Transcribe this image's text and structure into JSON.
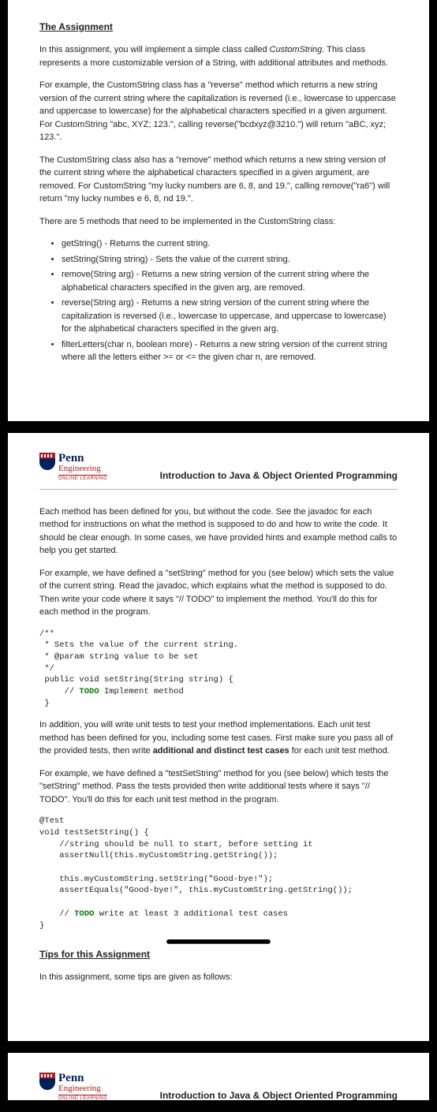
{
  "page1": {
    "title": "The Assignment",
    "p1_a": "In this assignment, you will implement a simple class called ",
    "p1_i": "CustomString",
    "p1_b": ".  This class represents a more customizable version of a String, with additional attributes and methods.",
    "p2": "For example, the CustomString class has a \"reverse\" method which returns a new string version of the current string where the capitalization is reversed (i.e., lowercase to uppercase and uppercase to lowercase) for the alphabetical characters specified in a given argument.  For CustomString \"abc, XYZ; 123.\", calling reverse(\"bcdxyz@3210.\") will return \"aBC, xyz; 123.\".",
    "p3": "The CustomString class also has a \"remove\" method which returns a new string version of the current string where the alphabetical characters specified in a given argument, are removed. For CustomString \"my lucky numbers are 6, 8, and 19.\", calling remove(\"ra6\") will return \"my lucky numbes e 6, 8, nd 19.\".",
    "p4": "There are 5 methods that need to be implemented in the CustomString class:",
    "methods": [
      "getString() - Returns the current string.",
      "setString(String string) - Sets the value of the current string.",
      "remove(String arg) - Returns a new string version of the current string where the alphabetical characters specified in the given arg, are removed.",
      "reverse(String arg) - Returns a new string version of the current string where the capitalization is reversed (i.e., lowercase to uppercase, and uppercase to lowercase) for the alphabetical characters specified in the given arg.",
      "filterLetters(char n, boolean more) - Returns a new string version of the current string where all the letters either >= or <= the given char n, are removed."
    ]
  },
  "logo": {
    "penn": "Penn",
    "eng": "Engineering",
    "online": "ONLINE LEARNING"
  },
  "course": "Introduction to Java & Object Oriented Programming",
  "page2": {
    "p1": "Each method has been defined for you, but without the code. See the javadoc for each method for instructions on what the method is supposed to do and how to write the code. It should be clear enough.   In some cases, we have provided hints and example method calls to help you get started.",
    "p2": "For example, we have defined a \"setString\" method for you (see below) which sets the value of the current string.  Read the javadoc, which explains what the method is supposed to do.  Then write your code where it says \"// TODO\" to implement the method.  You'll do this for each method in the program.",
    "code1a": "/**\n * Sets the value of the current string.\n * @param string value to be set\n */\n public void setString(String string) {\n     // ",
    "code1todo": "TODO",
    "code1b": " Implement method\n }",
    "p3a": "In addition, you will write unit tests to test your method implementations.  Each unit test method has been defined for you, including some test cases.  First make sure you pass all of the provided tests, then write ",
    "p3bold": "additional and distinct test cases",
    "p3b": " for each unit test method.",
    "p4": "For example, we have defined a \"testSetString\" method for you (see below) which tests the \"setString\" method.  Pass the tests provided then write additional tests where it says \"// TODO\".  You'll do this for each unit test method in the program.",
    "code2a": "@Test\nvoid testSetString() {\n    //string should be null to start, before setting it\n    assertNull(this.myCustomString.getString());\n\n    this.myCustomString.setString(\"Good-bye!\");\n    assertEquals(\"Good-bye!\", this.myCustomString.getString());\n\n    // ",
    "code2todo": "TODO",
    "code2b": " write at least 3 additional test cases\n}",
    "tipsTitle": "Tips for this Assignment",
    "tipsP": "In this assignment, some tips are given as follows:"
  }
}
